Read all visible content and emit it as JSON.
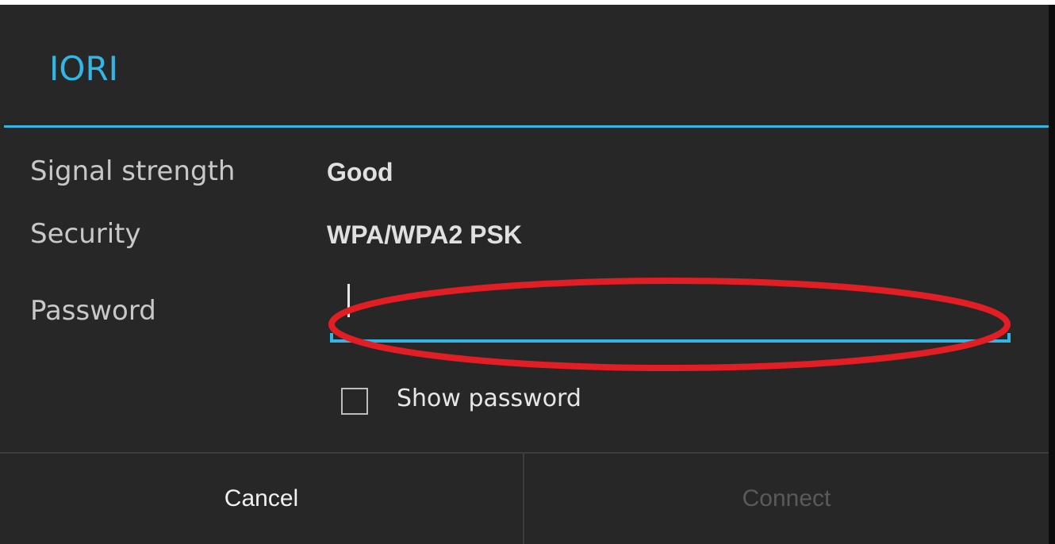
{
  "dialog": {
    "title": "IORI",
    "accent_color": "#33b5e5",
    "background_color": "#272727"
  },
  "details": [
    {
      "label": "Signal strength",
      "value": "Good"
    },
    {
      "label": "Security",
      "value": "WPA/WPA2 PSK"
    }
  ],
  "password": {
    "label": "Password",
    "value": "",
    "focused": true
  },
  "show_password": {
    "label": "Show password",
    "checked": false
  },
  "buttons": {
    "cancel": "Cancel",
    "connect": "Connect",
    "connect_enabled": false
  },
  "annotation": {
    "shape": "ellipse",
    "color": "#e01e24",
    "target": "password-input"
  }
}
